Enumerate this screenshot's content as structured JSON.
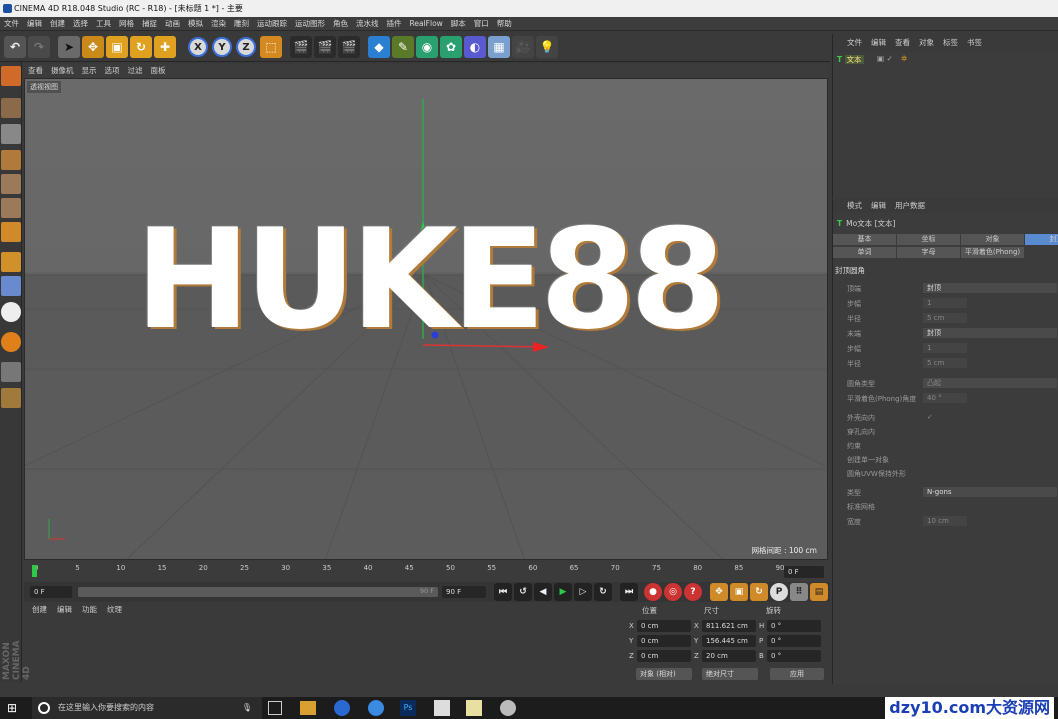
{
  "title": "CINEMA 4D R18.048 Studio (RC - R18) - [未标题 1 *] - 主要",
  "menu": [
    "文件",
    "编辑",
    "创建",
    "选择",
    "工具",
    "网格",
    "捕捉",
    "动画",
    "模拟",
    "渲染",
    "雕刻",
    "运动跟踪",
    "运动图形",
    "角色",
    "流水线",
    "插件",
    "RealFlow",
    "脚本",
    "窗口",
    "帮助"
  ],
  "viewport": {
    "menu": [
      "查看",
      "摄像机",
      "显示",
      "选项",
      "过滤",
      "面板"
    ],
    "label": "透视视图",
    "grid_info": "网格间距 : 100 cm",
    "text3d": "HUKE88"
  },
  "timeline": {
    "ticks": [
      "0",
      "5",
      "10",
      "15",
      "20",
      "25",
      "30",
      "35",
      "40",
      "45",
      "50",
      "55",
      "60",
      "65",
      "70",
      "75",
      "80",
      "85",
      "90"
    ],
    "current": "0 F",
    "start": "0 F",
    "end": "90 F",
    "end2": "90 F",
    "range_end": "90 F"
  },
  "material_menu": [
    "创建",
    "编辑",
    "功能",
    "纹理"
  ],
  "coords": {
    "headers": [
      "位置",
      "尺寸",
      "旋转"
    ],
    "pos": [
      "0 cm",
      "0 cm",
      "0 cm"
    ],
    "size": [
      "811.621 cm",
      "156.445 cm",
      "20 cm"
    ],
    "rot": [
      "0 °",
      "0 °",
      "0 °"
    ],
    "axes_pos": [
      "X",
      "Y",
      "Z"
    ],
    "axes_size": [
      "X",
      "Y",
      "Z"
    ],
    "axes_rot": [
      "H",
      "P",
      "B"
    ],
    "mode1": "对象 (相对)",
    "mode2": "绝对尺寸",
    "apply": "应用"
  },
  "objects": {
    "menu": [
      "文件",
      "编辑",
      "查看",
      "对象",
      "标签",
      "书签"
    ],
    "item": "文本"
  },
  "attributes": {
    "menu": [
      "模式",
      "编辑",
      "用户数据"
    ],
    "title": "Mo文本 [文本]",
    "tabs1": [
      "基本",
      "坐标",
      "对象",
      "封顶"
    ],
    "tabs2": [
      "单词",
      "字母",
      "平滑着色(Phong)"
    ],
    "section": "封顶圆角",
    "rows": [
      [
        "顶端",
        "封顶"
      ],
      [
        "步幅",
        "1"
      ],
      [
        "半径",
        "5 cm"
      ],
      [
        "末端",
        "封顶"
      ],
      [
        "步幅",
        "1"
      ],
      [
        "半径",
        "5 cm"
      ],
      [
        "圆角类型",
        "凸起"
      ],
      [
        "平滑着色(Phong)角度",
        "40 °"
      ],
      [
        "外壳向内",
        "✓"
      ],
      [
        "穿孔向内",
        ""
      ],
      [
        "约束",
        ""
      ],
      [
        "创建单一对象",
        ""
      ],
      [
        "圆角UVW保持外形",
        ""
      ],
      [
        "类型",
        "N-gons"
      ],
      [
        "标准网格",
        ""
      ],
      [
        "宽度",
        "10 cm"
      ]
    ]
  },
  "taskbar": {
    "search": "在这里输入你要搜索的内容"
  },
  "watermark": "dzy10.com大资源网"
}
